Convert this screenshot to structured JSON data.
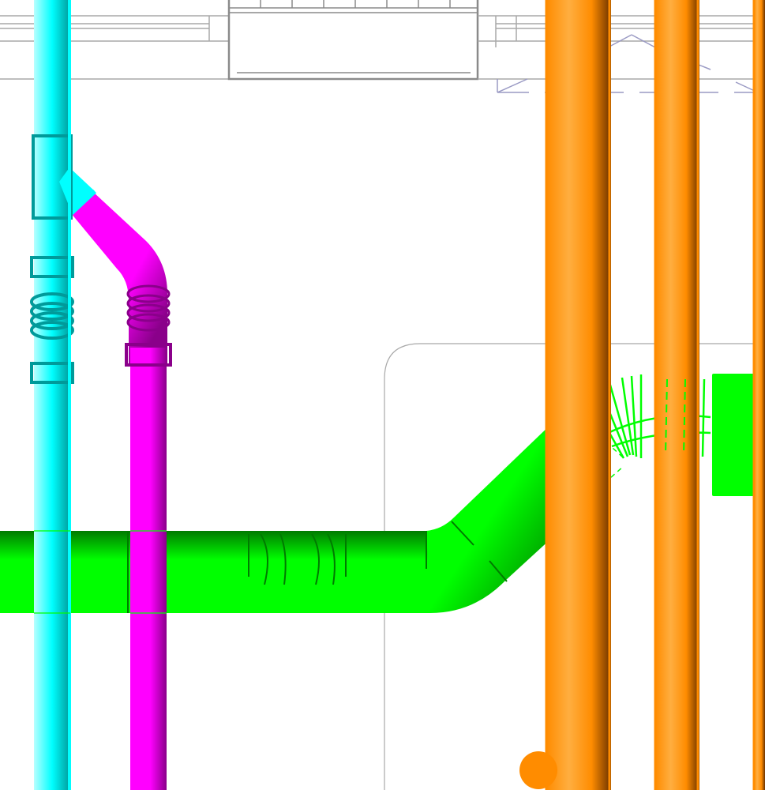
{
  "view": {
    "background": "#ffffff",
    "linework_color": "#a8a8a8",
    "linework_color_dark": "#8a8a8a",
    "hatch_color": "#9a9ac4"
  },
  "pipes": {
    "cyan": {
      "color": "#00ffff",
      "shade": "#009a9a",
      "highlight": "#b8ffff"
    },
    "magenta": {
      "color": "#ff00ff",
      "shade": "#8a008a",
      "highlight": "#ffb0ff"
    },
    "green": {
      "color": "#00ff00",
      "shade": "#007a00",
      "highlight": "#c8ffc8"
    },
    "orange": {
      "color": "#ff8c00",
      "shade": "#6a3200",
      "highlight": "#ffae40"
    }
  }
}
